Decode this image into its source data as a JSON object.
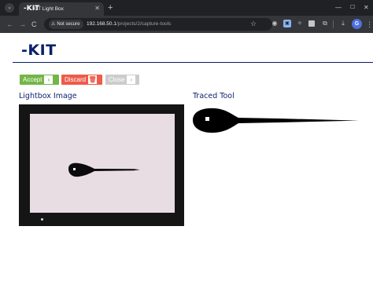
{
  "browser": {
    "tab": {
      "favicon": "-KIT",
      "title": "KIT Light Box"
    },
    "address": {
      "security_label": "Not secure",
      "url_host": "192.168.50.1",
      "url_path": "/projects/2/capture-tools"
    },
    "profile_initial": "G",
    "icons": {
      "tab_menu": "chevron-down-icon",
      "close": "close-icon",
      "new_tab": "plus-icon",
      "back": "back-arrow-icon",
      "forward": "forward-arrow-icon",
      "reload": "reload-icon",
      "warning": "warning-icon",
      "bookmark": "star-icon",
      "download": "download-icon",
      "menu": "kebab-menu-icon"
    }
  },
  "page": {
    "logo": "-KIT",
    "buttons": {
      "accept_label": "Accept",
      "discard_label": "Discard",
      "close_label": "Close"
    },
    "lightbox_title": "Lightbox Image",
    "traced_title": "Traced Tool"
  },
  "colors": {
    "brand_navy": "#0b1f6b",
    "accept_green": "#73b547",
    "discard_red": "#ef5a4a",
    "close_grey": "#cccccc",
    "lightbox_panel": "#e9dde4"
  }
}
